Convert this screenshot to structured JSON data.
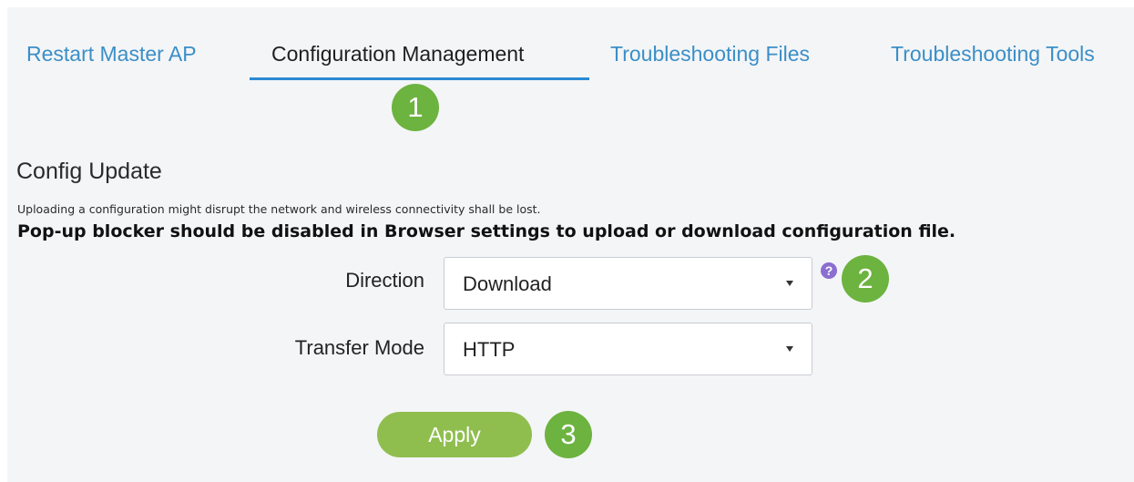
{
  "tabs": [
    {
      "label": "Restart Master AP",
      "active": false
    },
    {
      "label": "Configuration Management",
      "active": true
    },
    {
      "label": "Troubleshooting Files",
      "active": false
    },
    {
      "label": "Troubleshooting Tools",
      "active": false
    }
  ],
  "steps": [
    "1",
    "2",
    "3"
  ],
  "section": {
    "title": "Config Update",
    "info": "Uploading a configuration might disrupt the network and wireless connectivity shall be lost.",
    "warning": "Pop-up blocker should be disabled in Browser settings to upload or download configuration file."
  },
  "form": {
    "direction": {
      "label": "Direction",
      "value": "Download"
    },
    "transfer_mode": {
      "label": "Transfer Mode",
      "value": "HTTP"
    },
    "help_glyph": "?",
    "apply_label": "Apply"
  },
  "colors": {
    "tab_link": "#3a8fc7",
    "tab_underline": "#2a8ad4",
    "step_badge": "#6db33f",
    "apply_button": "#8fbe4f",
    "help_icon": "#8a6ed1",
    "panel_background": "#f4f5f7"
  },
  "icons": {
    "help": "question-circle-icon",
    "dropdown": "caret-down-icon"
  }
}
